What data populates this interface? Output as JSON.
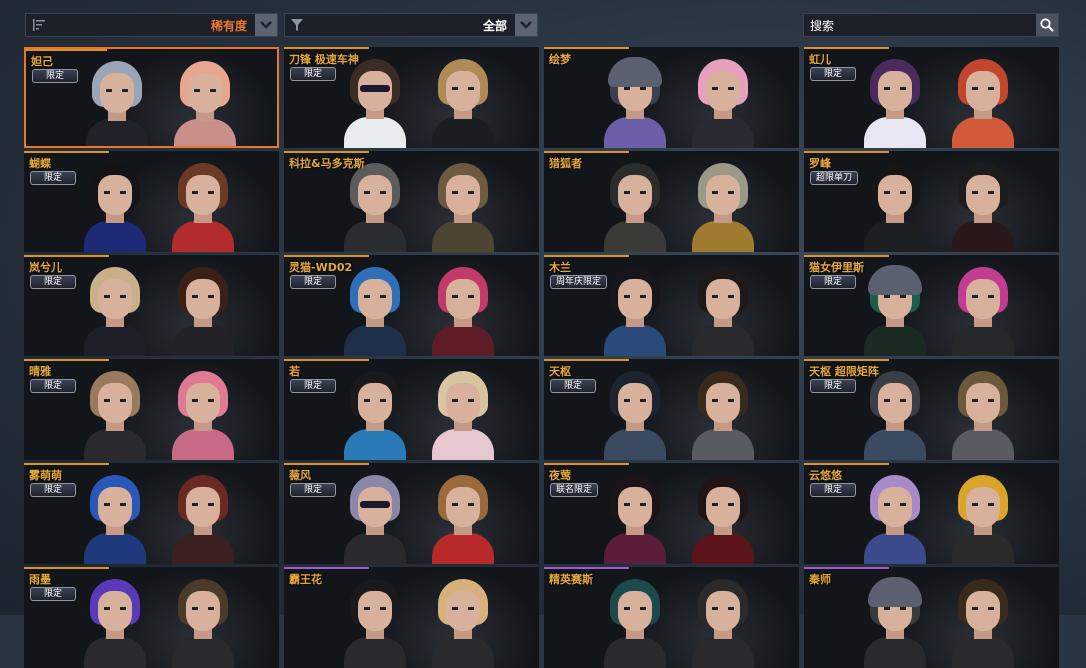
{
  "toolbar": {
    "sort": {
      "value": "稀有度",
      "color": "#e8762c",
      "icon": "sort-lines-icon"
    },
    "filter": {
      "value": "全部",
      "color": "#ffffff",
      "icon": "funnel-icon"
    },
    "search": {
      "value": "搜索",
      "icon": "magnifier-icon"
    }
  },
  "colors": {
    "gold": "#d9932a",
    "purple": "#a05bd3",
    "selected": "#e8762c"
  },
  "cards": [
    {
      "name": "妲己",
      "tag": "限定",
      "selected": true,
      "line": "gold",
      "hair": [
        "#9aa6b8",
        "#e8a68f"
      ],
      "body": [
        "#20232a",
        "#c9908a"
      ]
    },
    {
      "name": "刀锋 极速车神",
      "tag": "限定",
      "line": "gold",
      "hair": [
        "#3b2d24",
        "#b08a55"
      ],
      "body": [
        "#e9ecef",
        "#1a1d22"
      ],
      "glasses": true
    },
    {
      "name": "绘梦",
      "tag": "",
      "line": "gold",
      "hair": [
        "#3a3f52",
        "#e8a0c0"
      ],
      "body": [
        "#6c5fa8",
        "#2a2a33"
      ],
      "helmet": true
    },
    {
      "name": "虹儿",
      "tag": "限定",
      "line": "gold",
      "hair": [
        "#4b2b5e",
        "#c2462e"
      ],
      "body": [
        "#e8e6f2",
        "#d25a3a"
      ]
    },
    {
      "name": "蝴蝶",
      "tag": "限定",
      "line": "gold",
      "hair": [
        "#141418",
        "#6b3a25"
      ],
      "body": [
        "#1d2a78",
        "#b22c2c"
      ]
    },
    {
      "name": "科拉&马多克斯",
      "tag": "",
      "line": "gold",
      "hair": [
        "#5c5c5c",
        "#6e5b3f"
      ],
      "body": [
        "#2a2c30",
        "#4d4431"
      ]
    },
    {
      "name": "猎狐者",
      "tag": "",
      "line": "gold",
      "hair": [
        "#2c2c2c",
        "#9a9886"
      ],
      "body": [
        "#3a3a36",
        "#a07a2e"
      ]
    },
    {
      "name": "罗峰",
      "tag": "超限单刀",
      "line": "gold",
      "hair": [
        "#161616",
        "#1c1c1c"
      ],
      "body": [
        "#1c1e22",
        "#2a1818"
      ]
    },
    {
      "name": "岚兮儿",
      "tag": "限定",
      "line": "gold",
      "hair": [
        "#c9b088",
        "#3a2016"
      ],
      "body": [
        "#1d1f28",
        "#222228"
      ]
    },
    {
      "name": "灵猫-WD02",
      "tag": "限定",
      "line": "gold",
      "hair": [
        "#2f6fb8",
        "#c23a6a"
      ],
      "body": [
        "#1e2f4a",
        "#601c26"
      ]
    },
    {
      "name": "木兰",
      "tag": "周年庆限定",
      "line": "gold",
      "hair": [
        "#17161a",
        "#1e1a1a"
      ],
      "body": [
        "#2a4a7a",
        "#2a2a2e"
      ]
    },
    {
      "name": "猫女伊里斯",
      "tag": "限定",
      "line": "gold",
      "hair": [
        "#1c5e4c",
        "#c23c92"
      ],
      "body": [
        "#1c2a24",
        "#25292a"
      ],
      "helmet": true
    },
    {
      "name": "晴雅",
      "tag": "限定",
      "line": "gold",
      "hair": [
        "#9a7a5e",
        "#e07a92"
      ],
      "body": [
        "#2a2a2e",
        "#c86a86"
      ]
    },
    {
      "name": "若",
      "tag": "限定",
      "line": "gold",
      "hair": [
        "#1a1a1c",
        "#d8c49e"
      ],
      "body": [
        "#2a7ab8",
        "#e8c8d0"
      ]
    },
    {
      "name": "天枢",
      "tag": "限定",
      "line": "gold",
      "hair": [
        "#1c2430",
        "#3a2a1c"
      ],
      "body": [
        "#3a4a60",
        "#5a5a62"
      ]
    },
    {
      "name": "天枢 超限矩阵",
      "tag": "限定",
      "line": "gold",
      "hair": [
        "#3a3e46",
        "#6a5a3a"
      ],
      "body": [
        "#3a4a60",
        "#5a5a62"
      ]
    },
    {
      "name": "雾萌萌",
      "tag": "限定",
      "line": "gold",
      "hair": [
        "#2a58b8",
        "#6a2a22"
      ],
      "body": [
        "#1f3a7a",
        "#3a2020"
      ]
    },
    {
      "name": "薇风",
      "tag": "限定",
      "line": "gold",
      "hair": [
        "#8a86a8",
        "#9a6a3a"
      ],
      "body": [
        "#2a2a2e",
        "#b82a2a"
      ],
      "glasses": true
    },
    {
      "name": "夜莺",
      "tag": "联名限定",
      "line": "gold",
      "hair": [
        "#1c1418",
        "#201416"
      ],
      "body": [
        "#5a1e3a",
        "#5a141a"
      ]
    },
    {
      "name": "云悠悠",
      "tag": "限定",
      "line": "gold",
      "hair": [
        "#a88ac8",
        "#d8a42a"
      ],
      "body": [
        "#3a4a8a",
        "#2a2a2a"
      ]
    },
    {
      "name": "雨墨",
      "tag": "限定",
      "line": "gold",
      "hair": [
        "#5a3ab8",
        "#4a3a2a"
      ],
      "body": [
        "#2a2a2e",
        "#2a2a2e"
      ]
    },
    {
      "name": "霸王花",
      "tag": "",
      "line": "purple",
      "hair": [
        "#1a1a1c",
        "#d8b07a"
      ],
      "body": [
        "#2a2a2e",
        "#2a2a2e"
      ]
    },
    {
      "name": "精英赛斯",
      "tag": "",
      "line": "purple",
      "hair": [
        "#1c4a4a",
        "#2a2a2a"
      ],
      "body": [
        "#2a2a2e",
        "#2a2a2e"
      ]
    },
    {
      "name": "秦师",
      "tag": "",
      "line": "purple",
      "hair": [
        "#3a3a3a",
        "#3a2a1c"
      ],
      "body": [
        "#2a2a2e",
        "#2a2a2e"
      ],
      "helmet": true
    }
  ]
}
